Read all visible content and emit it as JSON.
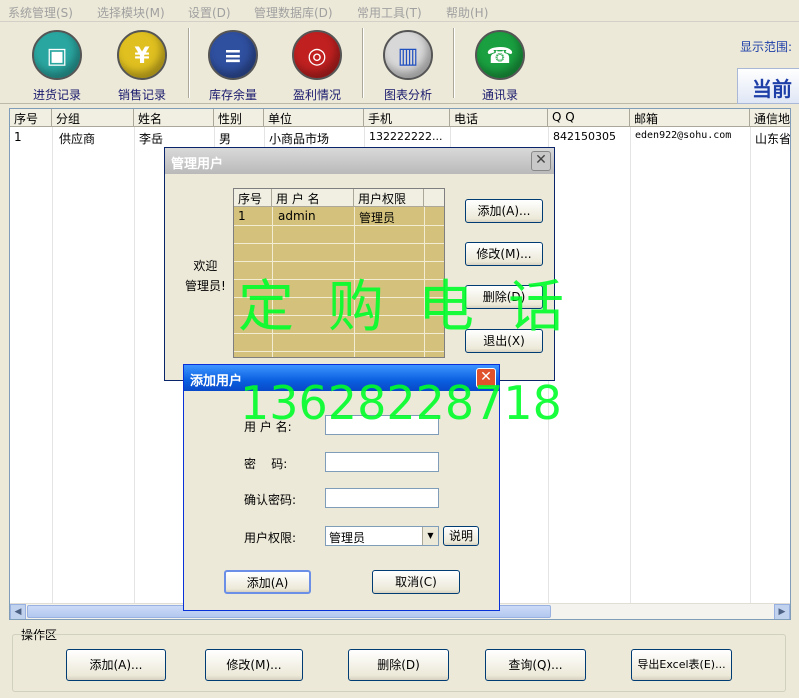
{
  "menu": [
    "系统管理(S)",
    "选择模块(M)",
    "设置(D)",
    "管理数据库(D)",
    "常用工具(T)",
    "帮助(H)"
  ],
  "toolbar": {
    "buttons": [
      {
        "label": "进货记录",
        "icon": "box-icon",
        "glyph": "▣",
        "color": "#2aa6a0"
      },
      {
        "label": "销售记录",
        "icon": "yen-coin-icon",
        "glyph": "¥",
        "color": "#e0c020"
      },
      {
        "label": "库存余量",
        "icon": "database-icon",
        "glyph": "≡",
        "color": "#2f4f9f"
      },
      {
        "label": "盈利情况",
        "icon": "coins-icon",
        "glyph": "◎",
        "color": "#c02020"
      },
      {
        "label": "图表分析",
        "icon": "bar-chart-icon",
        "glyph": "▥",
        "color": "#d8d8d8"
      },
      {
        "label": "通讯录",
        "icon": "telephone-icon",
        "glyph": "☎",
        "color": "#1aa040"
      }
    ],
    "range_label": "显示范围:",
    "current_label": "当前"
  },
  "grid": {
    "columns": [
      "序号",
      "分组",
      "姓名",
      "性别",
      "单位",
      "手机",
      "电话",
      "Q Q",
      "邮箱",
      "通信地"
    ],
    "rows": [
      [
        "1",
        "供应商",
        "李岳",
        "男",
        "小商品市场",
        "132222222...",
        "",
        "842150305",
        "eden922@sohu.com",
        "山东省"
      ]
    ]
  },
  "manage_dialog": {
    "title": "管理用户",
    "welcome_1": "欢迎",
    "welcome_2": "管理员!",
    "columns": [
      "序号",
      "用 户 名",
      "用户权限"
    ],
    "rows": [
      [
        "1",
        "admin",
        "管理员"
      ]
    ],
    "buttons": {
      "add": "添加(A)...",
      "edit": "修改(M)...",
      "delete": "删除(D)",
      "exit": "退出(X)"
    }
  },
  "add_dialog": {
    "title": "添加用户",
    "username_label": "用 户 名:",
    "password_label": "密    码:",
    "confirm_label": "确认密码:",
    "permission_label": "用户权限:",
    "permission_value": "管理员",
    "explain": "说明",
    "add": "添加(A)",
    "cancel": "取消(C)",
    "username_value": "",
    "password_value": "",
    "confirm_value": ""
  },
  "watermark": {
    "line1": "定购电话",
    "line2": "13628228718"
  },
  "ops": {
    "title": "操作区",
    "add": "添加(A)...",
    "edit": "修改(M)...",
    "delete": "删除(D)",
    "query": "查询(Q)...",
    "export": "导出Excel表(E)..."
  }
}
